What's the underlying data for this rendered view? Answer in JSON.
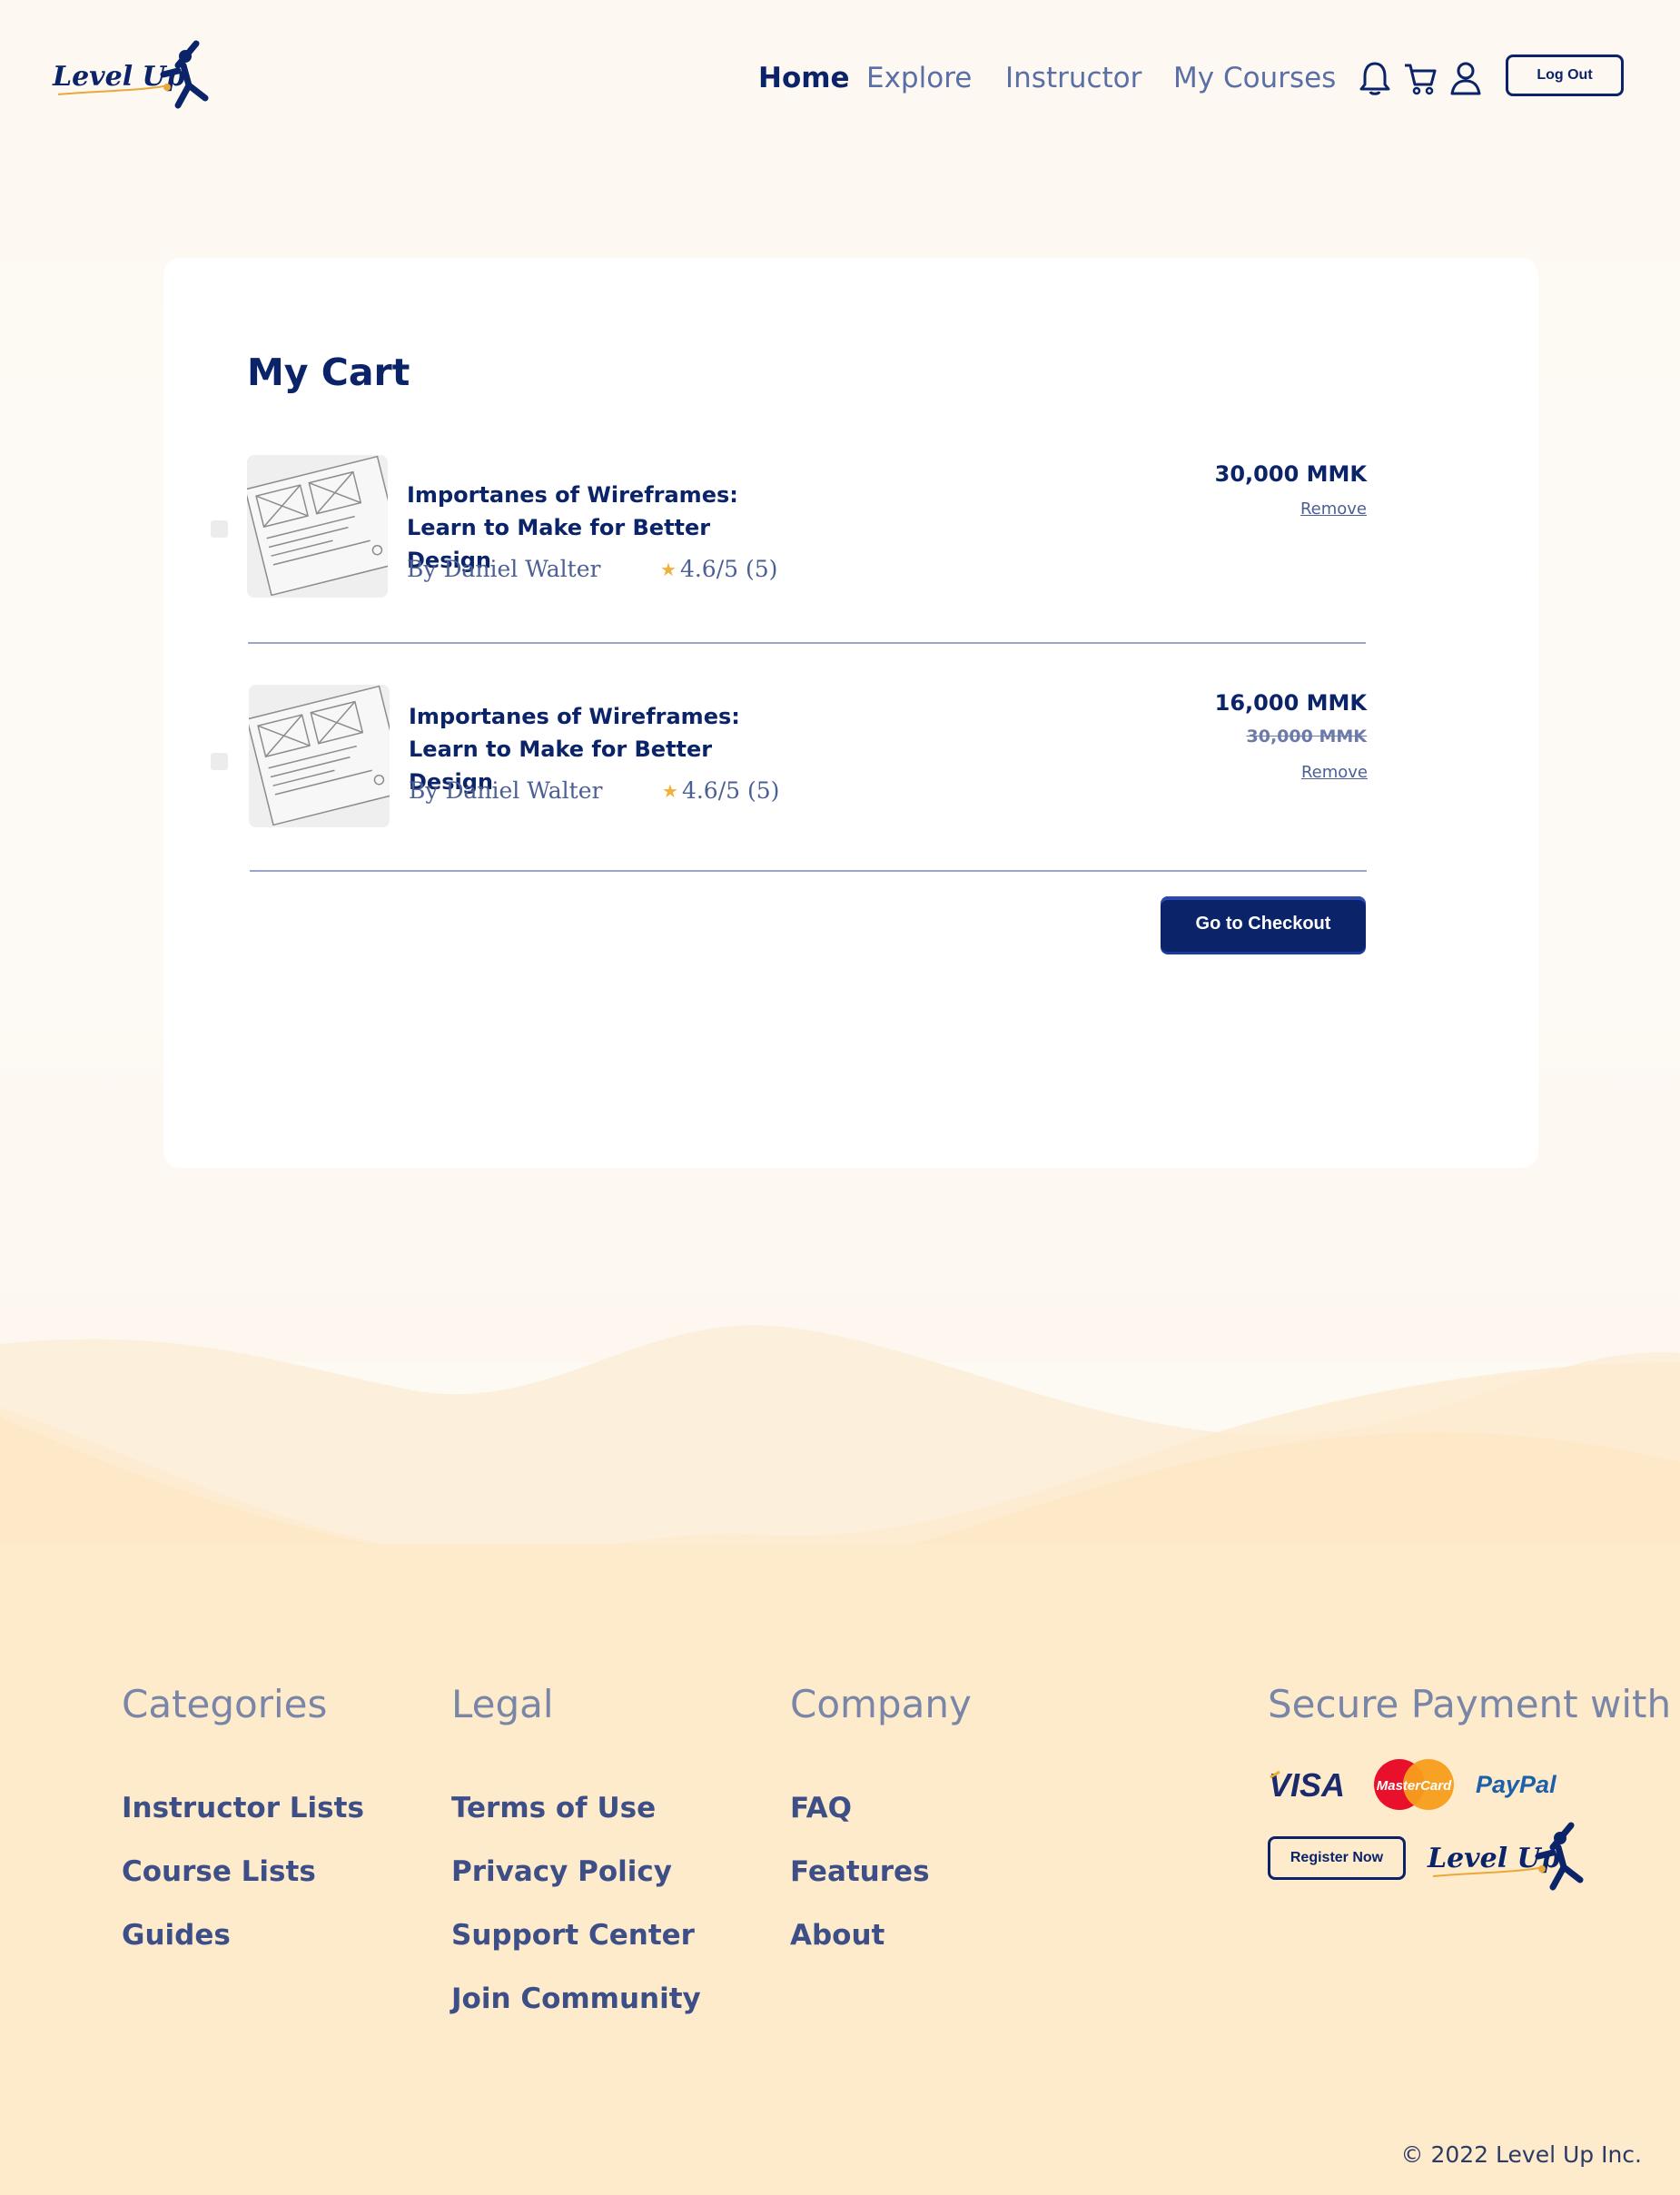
{
  "brand": {
    "name": "Level Up",
    "primary_color": "#0b2368",
    "accent_color": "#f0b23c"
  },
  "header": {
    "nav": [
      {
        "label": "Home",
        "active": true
      },
      {
        "label": "Explore",
        "active": false
      },
      {
        "label": "Instructor",
        "active": false
      },
      {
        "label": "My Courses",
        "active": false
      }
    ],
    "icons": [
      "bell-icon",
      "cart-icon",
      "user-icon"
    ],
    "logout_label": "Log Out"
  },
  "cart": {
    "title": "My Cart",
    "items": [
      {
        "title": "Importanes of Wireframes: Learn to Make for Better Design",
        "author": "By Daniel Walter",
        "rating": "4.6/5 (5)",
        "price": "30,000 MMK",
        "old_price": "",
        "remove_label": "Remove"
      },
      {
        "title": "Importanes of Wireframes: Learn to Make for Better Design",
        "author": "By Daniel Walter",
        "rating": "4.6/5 (5)",
        "price": "16,000 MMK",
        "old_price": "30,000 MMK",
        "remove_label": "Remove"
      }
    ],
    "checkout_label": "Go to Checkout"
  },
  "footer": {
    "columns": [
      {
        "heading": "Categories",
        "links": [
          "Instructor Lists",
          "Course Lists",
          "Guides"
        ]
      },
      {
        "heading": "Legal",
        "links": [
          "Terms of Use",
          "Privacy Policy",
          "Support Center",
          "Join Community"
        ]
      },
      {
        "heading": "Company",
        "links": [
          "FAQ",
          "Features",
          "About"
        ]
      }
    ],
    "payment": {
      "heading": "Secure Payment with",
      "methods": [
        "VISA",
        "MasterCard",
        "PayPal"
      ],
      "register_label": "Register Now"
    },
    "copyright": "© 2022 Level Up Inc."
  }
}
